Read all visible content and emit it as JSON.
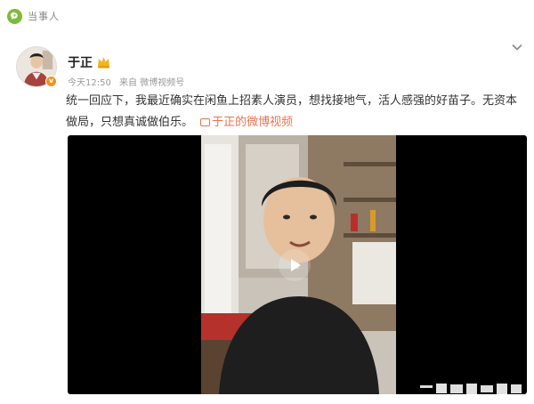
{
  "app": {
    "name": "当事人",
    "accent": "#7dbb3b"
  },
  "post": {
    "author": "于正",
    "time": "今天12:50",
    "source": "来自 微博视频号",
    "text": "统一回应下，我最近确实在闲鱼上招素人演员，想找接地气，活人感强的好苗子。无资本做局，只想真诚做伯乐。",
    "link_label": "于正的微博视频",
    "link_color": "#eb7350",
    "verified_color": "#f0931e"
  },
  "video": {
    "play_icon": "play-icon"
  }
}
